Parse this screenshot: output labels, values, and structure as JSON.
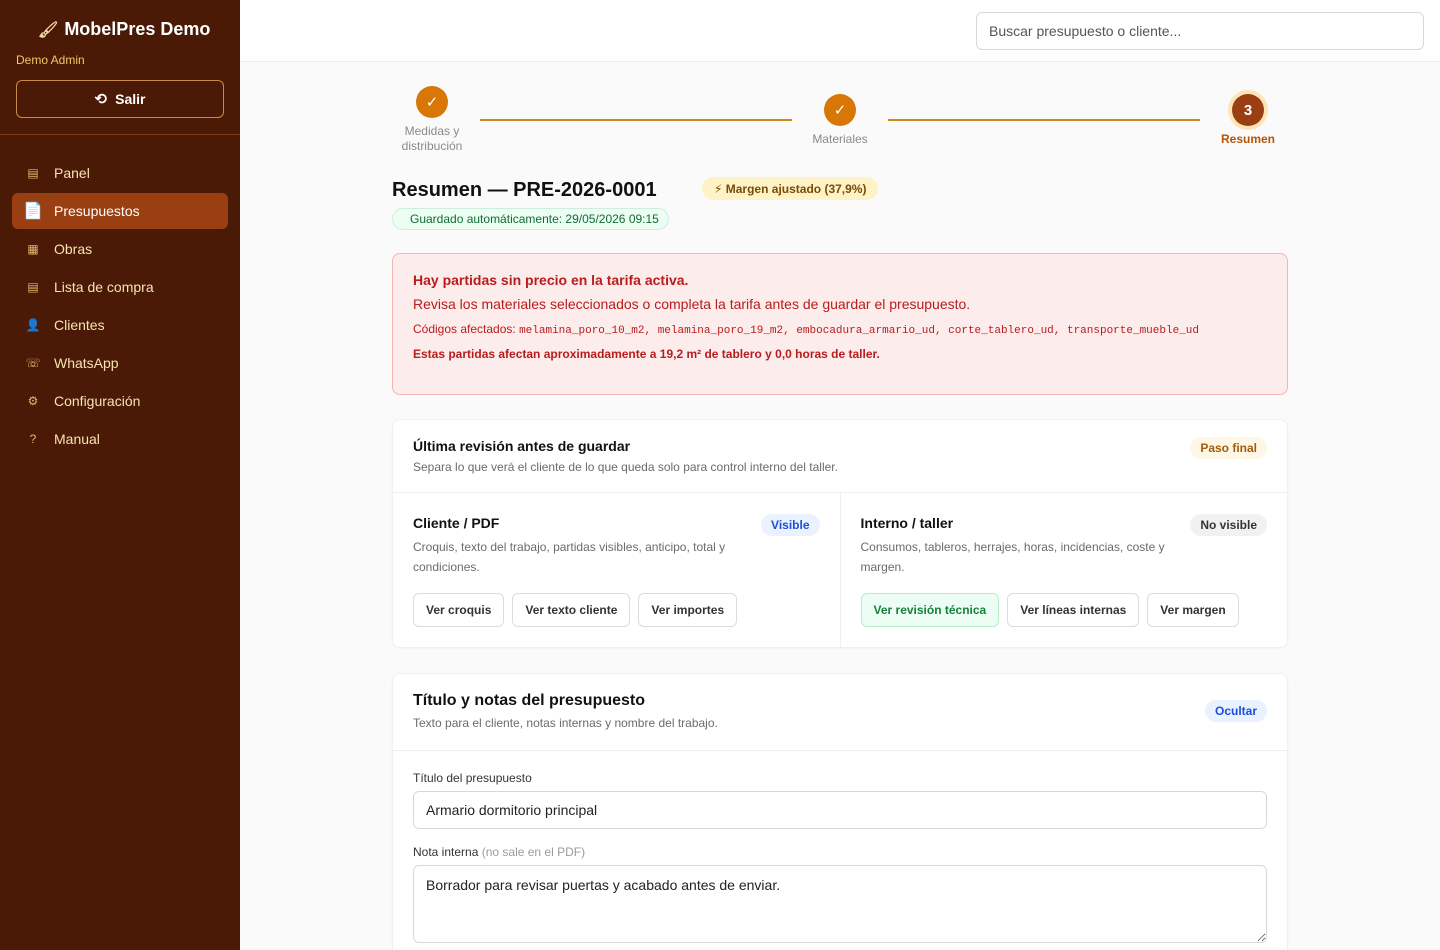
{
  "brand": {
    "icon": "paintbrush-icon",
    "name": "MobelPres Demo",
    "user": "Demo Admin",
    "logout_label": "Salir"
  },
  "nav": {
    "items": [
      {
        "icon": "▤",
        "label": "Panel"
      },
      {
        "icon": "📄",
        "label": "Presupuestos",
        "active": true
      },
      {
        "icon": "▦",
        "label": "Obras"
      },
      {
        "icon": "▤",
        "label": "Lista de compra"
      },
      {
        "icon": "👤",
        "label": "Clientes"
      },
      {
        "icon": "☏",
        "label": "WhatsApp"
      },
      {
        "icon": "⚙",
        "label": "Configuración"
      },
      {
        "icon": "?",
        "label": "Manual"
      }
    ]
  },
  "search": {
    "placeholder": "Buscar presupuesto o cliente..."
  },
  "stepper": {
    "steps": [
      {
        "mark": "✓",
        "label": "Medidas y distribución"
      },
      {
        "mark": "✓",
        "label": "Materiales"
      },
      {
        "mark": "3",
        "label": "Resumen"
      }
    ]
  },
  "summary": {
    "title": "Resumen — PRE-2026-0001",
    "margin_badge": "⚡ Margen ajustado (37,9%)",
    "autosave": "Guardado automáticamente: 29/05/2026 09:15"
  },
  "alert": {
    "title": "Hay partidas sin precio en la tarifa activa.",
    "text": "Revisa los materiales seleccionados o completa la tarifa antes de guardar el presupuesto.",
    "codes_label": "Códigos afectados:",
    "codes": "melamina_poro_10_m2, melamina_poro_19_m2, embocadura_armario_ud, corte_tablero_ud, transporte_mueble_ud",
    "footer": "Estas partidas afectan aproximadamente a 19,2 m² de tablero y 0,0 horas de taller."
  },
  "review": {
    "title": "Última revisión antes de guardar",
    "subtitle": "Separa lo que verá el cliente de lo que queda solo para control interno del taller.",
    "badge": "Paso final",
    "client": {
      "title": "Cliente / PDF",
      "desc": "Croquis, texto del trabajo, partidas visibles, anticipo, total y condiciones.",
      "badge": "Visible",
      "buttons": [
        "Ver croquis",
        "Ver texto cliente",
        "Ver importes"
      ]
    },
    "internal": {
      "title": "Interno / taller",
      "desc": "Consumos, tableros, herrajes, horas, incidencias, coste y margen.",
      "badge": "No visible",
      "buttons": [
        "Ver revisión técnica",
        "Ver líneas internas",
        "Ver margen"
      ]
    }
  },
  "notes": {
    "title": "Título y notas del presupuesto",
    "subtitle": "Texto para el cliente, notas internas y nombre del trabajo.",
    "toggle": "Ocultar",
    "title_label": "Título del presupuesto",
    "title_value": "Armario dormitorio principal",
    "note_label": "Nota interna",
    "note_hint": "(no sale en el PDF)",
    "note_value": "Borrador para revisar puertas y acabado antes de enviar."
  }
}
